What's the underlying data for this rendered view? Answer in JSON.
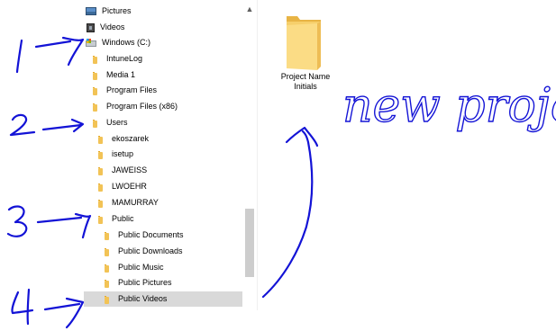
{
  "nav_tree": {
    "items": [
      {
        "label": "Pictures",
        "icon": "pictures-icon"
      },
      {
        "label": "Videos",
        "icon": "videos-icon"
      },
      {
        "label": "Windows (C:)",
        "icon": "drive-icon"
      },
      {
        "label": "IntuneLog",
        "icon": "folder-icon"
      },
      {
        "label": "Media 1",
        "icon": "folder-icon"
      },
      {
        "label": "Program Files",
        "icon": "folder-icon"
      },
      {
        "label": "Program Files (x86)",
        "icon": "folder-icon"
      },
      {
        "label": "Users",
        "icon": "folder-icon"
      },
      {
        "label": "ekoszarek",
        "icon": "folder-icon"
      },
      {
        "label": "isetup",
        "icon": "folder-icon"
      },
      {
        "label": "JAWEISS",
        "icon": "folder-icon"
      },
      {
        "label": "LWOEHR",
        "icon": "folder-icon"
      },
      {
        "label": "MAMURRAY",
        "icon": "folder-icon"
      },
      {
        "label": "Public",
        "icon": "folder-icon"
      },
      {
        "label": "Public Documents",
        "icon": "folder-icon"
      },
      {
        "label": "Public Downloads",
        "icon": "folder-icon"
      },
      {
        "label": "Public Music",
        "icon": "folder-icon"
      },
      {
        "label": "Public Pictures",
        "icon": "folder-icon"
      },
      {
        "label": "Public Videos",
        "icon": "folder-icon",
        "selected": true
      }
    ]
  },
  "scrollbar": {
    "up_arrow": "▲",
    "down_arrow": "▼"
  },
  "content": {
    "folder": {
      "name_line1": "Project Name",
      "name_line2": "Initials",
      "icon": "folder-icon"
    }
  },
  "annotations": {
    "handwritten_steps": [
      "1",
      "2",
      "3",
      "4"
    ],
    "handwritten_note": "new project",
    "ink_color": "#1313d6"
  },
  "colors": {
    "folder_yellow": "#f2c356",
    "selection_gray": "#d9d9d9",
    "scroll_thumb": "#cdcdcd"
  }
}
